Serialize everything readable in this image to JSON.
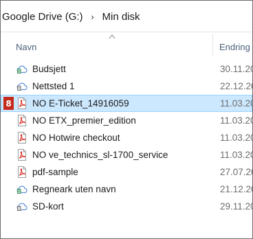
{
  "breadcrumb": {
    "items": [
      "Google Drive (G:)",
      "Min disk"
    ],
    "separator": "›"
  },
  "columns": {
    "name": "Navn",
    "date": "Endring"
  },
  "badge": "8",
  "files": [
    {
      "name": "Budsjett",
      "date": "30.11.20",
      "icon": "google-sheets-icon"
    },
    {
      "name": "Nettsted 1",
      "date": "22.12.20",
      "icon": "google-sites-icon"
    },
    {
      "name": "NO E-Ticket_14916059",
      "date": "11.03.20",
      "icon": "pdf-icon",
      "selected": true
    },
    {
      "name": "NO ETX_premier_edition",
      "date": "11.03.20",
      "icon": "pdf-icon"
    },
    {
      "name": "NO Hotwire checkout",
      "date": "11.03.20",
      "icon": "pdf-icon"
    },
    {
      "name": "NO ve_technics_sl-1700_service",
      "date": "11.03.20",
      "icon": "pdf-icon"
    },
    {
      "name": "pdf-sample",
      "date": "27.07.20",
      "icon": "pdf-icon"
    },
    {
      "name": "Regneark uten navn",
      "date": "21.12.20",
      "icon": "google-sheets-icon"
    },
    {
      "name": "SD-kort",
      "date": "29.11.20",
      "icon": "google-sites-icon"
    }
  ],
  "colors": {
    "selection": "#cce8ff",
    "selection_border": "#99d1ff",
    "pdf_red": "#d8261c",
    "badge_red": "#c42b1c",
    "cloud_blue": "#3a7bd5"
  }
}
